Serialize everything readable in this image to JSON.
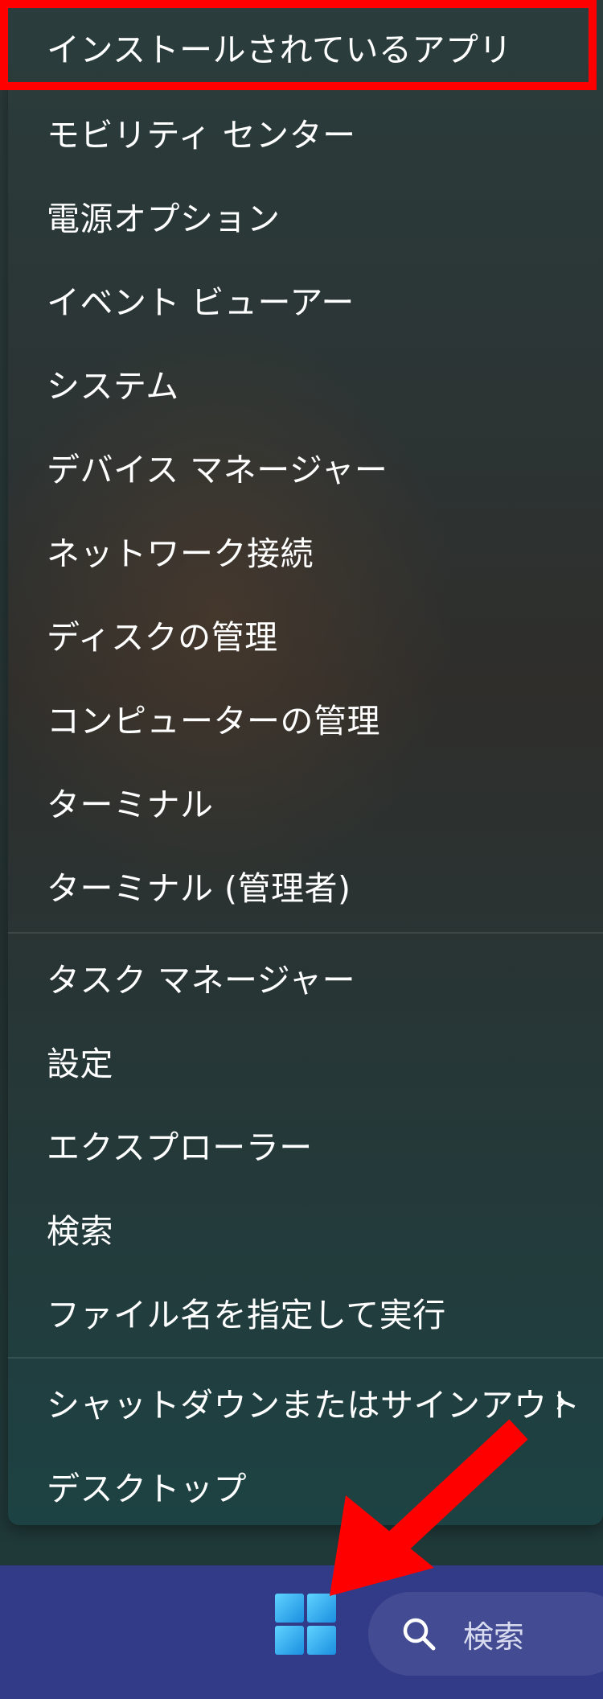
{
  "menu": {
    "items": [
      {
        "label": "インストールされているアプリ"
      },
      {
        "label": "モビリティ センター"
      },
      {
        "label": "電源オプション"
      },
      {
        "label": "イベント ビューアー"
      },
      {
        "label": "システム"
      },
      {
        "label": "デバイス マネージャー"
      },
      {
        "label": "ネットワーク接続"
      },
      {
        "label": "ディスクの管理"
      },
      {
        "label": "コンピューターの管理"
      },
      {
        "label": "ターミナル"
      },
      {
        "label": "ターミナル (管理者)"
      },
      {
        "label": "タスク マネージャー"
      },
      {
        "label": "設定"
      },
      {
        "label": "エクスプローラー"
      },
      {
        "label": "検索"
      },
      {
        "label": "ファイル名を指定して実行"
      },
      {
        "label": "シャットダウンまたはサインアウト",
        "submenu_icon": "chevron-right-icon"
      },
      {
        "label": "デスクトップ"
      }
    ],
    "highlighted_item": "インストールされているアプリ"
  },
  "taskbar": {
    "start_icon": "windows-logo-icon",
    "search": {
      "icon": "search-icon",
      "text": "検索"
    }
  },
  "annotations": {
    "highlight_color": "#ff0000",
    "arrow_color": "#ff0000",
    "arrow_icon": "arrow-pointer-icon"
  },
  "colors": {
    "menu_text": "#ffffff",
    "taskbar_bg": "#313b87",
    "start_accent": "#29b6f6"
  }
}
